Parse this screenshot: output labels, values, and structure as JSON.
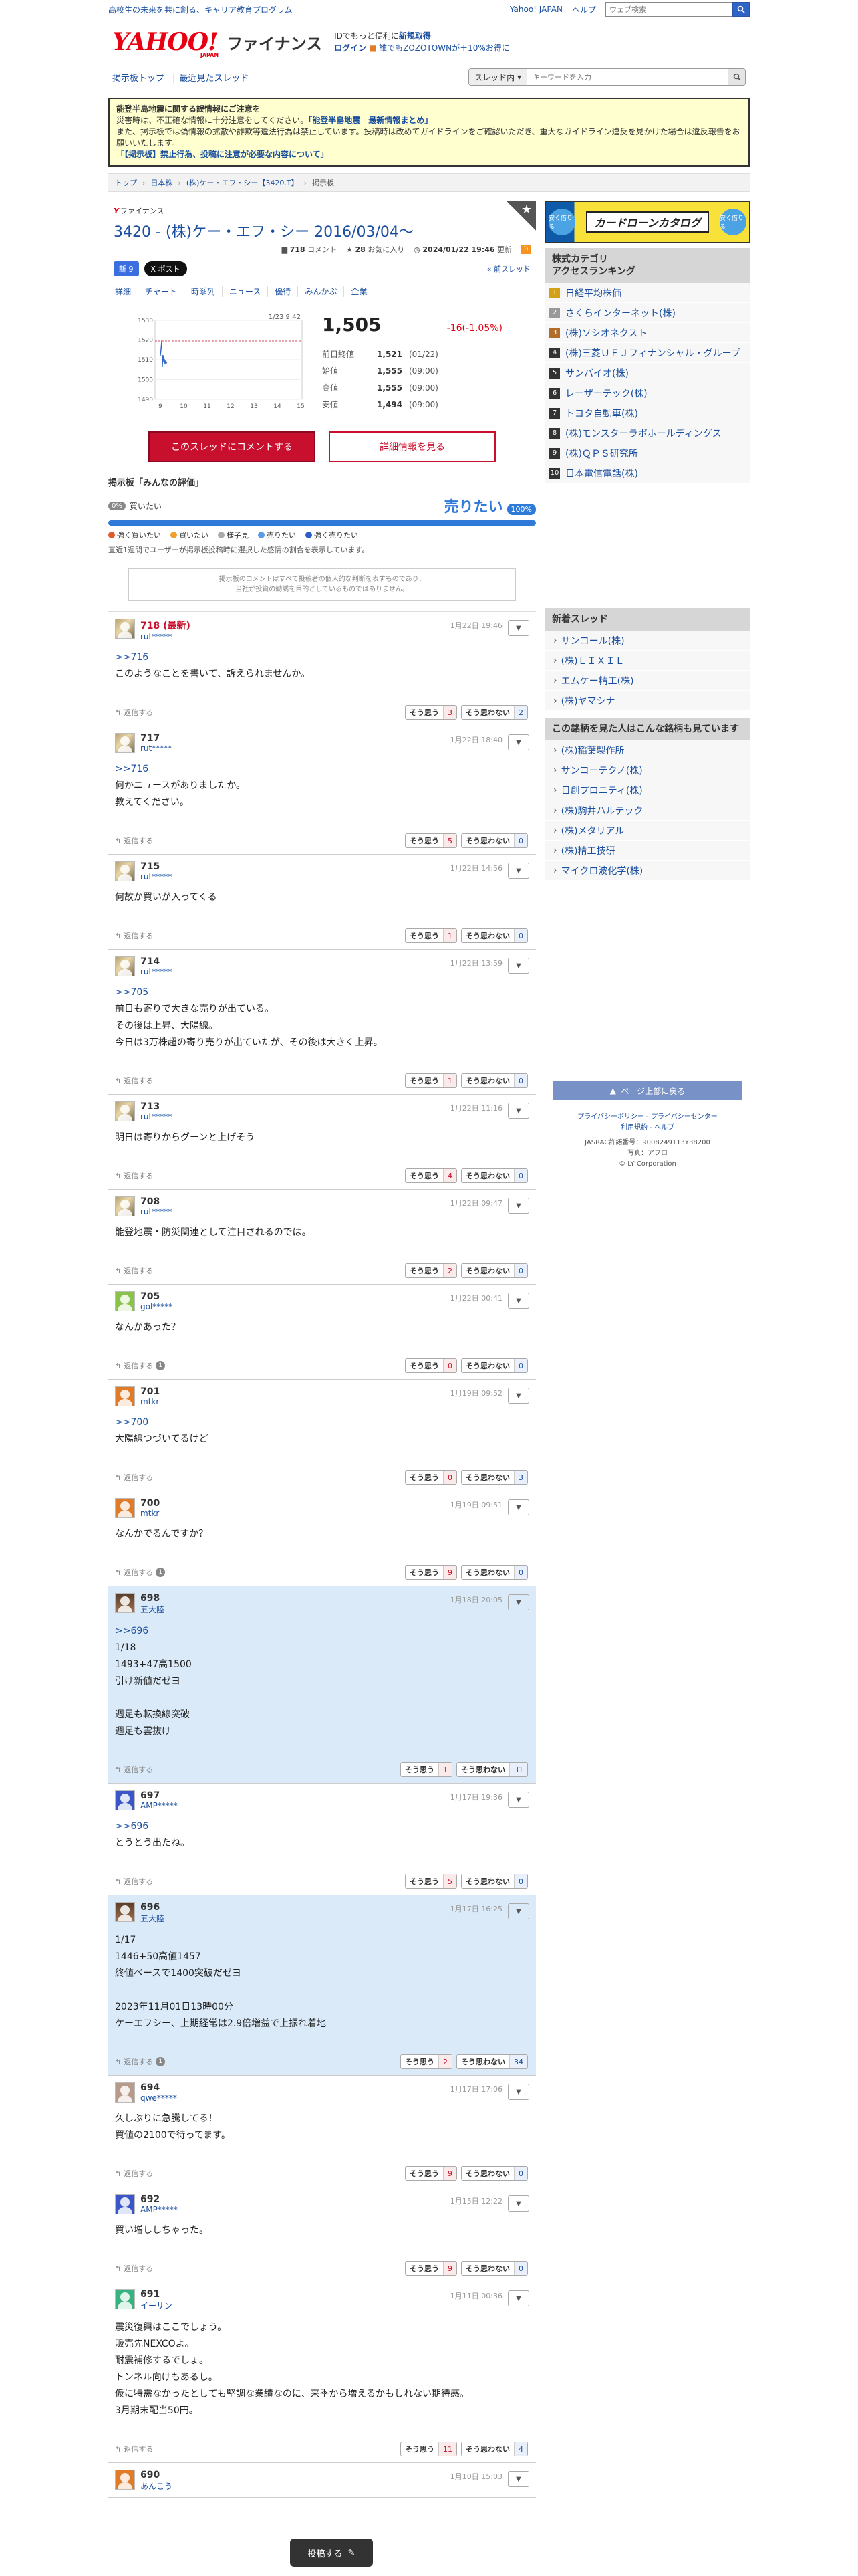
{
  "topbar": {
    "promo": "高校生の未来を共に創る、キャリア教育プログラム",
    "links": [
      "Yahoo! JAPAN",
      "ヘルプ"
    ],
    "search_placeholder": "ウェブ検索"
  },
  "header": {
    "logo": "YAHOO!",
    "logo_sub": "JAPAN",
    "service": "ファイナンス",
    "line1a": "IDでもっと便利に",
    "line1b": "新規取得",
    "login": "ログイン",
    "line2": "誰でもZOZOTOWNが＋10%お得に"
  },
  "nav": {
    "links": [
      "掲示板トップ",
      "最近見たスレッド"
    ],
    "select": "スレッド内",
    "search_placeholder": "キーワードを入力"
  },
  "notice": {
    "title": "能登半島地震に関する誤情報にご注意を",
    "l1a": "災害時は、不正確な情報に十分注意をしてください。",
    "l1b": "「能登半島地震　最新情報まとめ」",
    "l2": "また、掲示板では偽情報の拡散や詐欺等違法行為は禁止しています。投稿時は改めてガイドラインをご確認いただき、重大なガイドライン違反を見かけた場合は違反報告をお願いいたします。",
    "l3": "「【掲示板】禁止行為、投稿に注意が必要な内容について」"
  },
  "breadcrumb": [
    "トップ",
    "日本株",
    "(株)ケー・エフ・シー【3420.T】",
    "掲示板"
  ],
  "thread": {
    "brand": "ファイナンス",
    "title": "3420 - (株)ケー・エフ・シー 2016/03/04〜",
    "comments": "718",
    "comments_label": "コメント",
    "favs": "28",
    "favs_label": "お気に入り",
    "updated": "2024/01/22 19:46",
    "updated_label": "更新",
    "share1": "新 9",
    "share2": "X ポスト",
    "prev": "« 前スレッド"
  },
  "tabs": [
    "詳細",
    "チャート",
    "時系列",
    "ニュース",
    "優待",
    "みんかぶ",
    "企業"
  ],
  "price": {
    "time": "1/23 9:42",
    "value": "1,505",
    "change": "-16(-1.05%)",
    "rows": [
      {
        "l": "前日終値",
        "v": "1,521",
        "t": "(01/22)"
      },
      {
        "l": "始値",
        "v": "1,555",
        "t": "(09:00)"
      },
      {
        "l": "高値",
        "v": "1,555",
        "t": "(09:00)"
      },
      {
        "l": "安値",
        "v": "1,494",
        "t": "(09:00)"
      }
    ]
  },
  "chart_data": {
    "type": "line",
    "x": [
      "9",
      "10",
      "11",
      "12",
      "13",
      "14",
      "15"
    ],
    "yticks": [
      "1530",
      "1520",
      "1510",
      "1500",
      "1490"
    ],
    "ylim": [
      1490,
      1530
    ]
  },
  "buttons": {
    "comment": "このスレッドにコメントする",
    "detail": "詳細情報を見る"
  },
  "eval": {
    "title": "掲示板「みんなの評価」",
    "tag": "0%",
    "left": "買いたい",
    "right": "売りたい",
    "right_pct": "100%",
    "legend": [
      "強く買いたい",
      "買いたい",
      "様子見",
      "売りたい",
      "強く売りたい"
    ],
    "note": "直近1週間でユーザーが掲示板投稿時に選択した感情の割合を表示しています。",
    "legend_colors": [
      "#e05a2b",
      "#f3a02b",
      "#aaaaaa",
      "#5b9be6",
      "#2f5fc4"
    ]
  },
  "disclaimer": {
    "l1": "掲示板のコメントはすべて投稿者の個人的な判断を表すものであり、",
    "l2": "当社が投資の勧誘を目的としているものではありません。"
  },
  "labels": {
    "reply": "返信する",
    "yes": "そう思う",
    "no": "そう思わない"
  },
  "comments": [
    {
      "num": "718 (最新)",
      "user": "rut*****",
      "date": "1月22日 19:46",
      "lines": [
        ">>716",
        "このようなことを書いて、訴えられませんか。"
      ],
      "yes": "3",
      "no": "2",
      "latest": true
    },
    {
      "num": "717",
      "user": "rut*****",
      "date": "1月22日 18:40",
      "lines": [
        ">>716",
        "何かニュースがありましたか。",
        "教えてください。"
      ],
      "yes": "5",
      "no": "0"
    },
    {
      "num": "715",
      "user": "rut*****",
      "date": "1月22日 14:56",
      "lines": [
        "何故か買いが入ってくる"
      ],
      "yes": "1",
      "no": "0"
    },
    {
      "num": "714",
      "user": "rut*****",
      "date": "1月22日 13:59",
      "lines": [
        ">>705",
        "前日も寄りで大きな売りが出ている。",
        "その後は上昇、大陽線。",
        "今日は3万株超の寄り売りが出ていたが、その後は大きく上昇。"
      ],
      "yes": "1",
      "no": "0"
    },
    {
      "num": "713",
      "user": "rut*****",
      "date": "1月22日 11:16",
      "lines": [
        "明日は寄りからグーンと上げそう"
      ],
      "yes": "4",
      "no": "0"
    },
    {
      "num": "708",
      "user": "rut*****",
      "date": "1月22日 09:47",
      "lines": [
        "能登地震・防災関連として注目されるのでは。"
      ],
      "yes": "2",
      "no": "0"
    },
    {
      "num": "705",
      "user": "gol*****",
      "date": "1月22日 00:41",
      "lines": [
        "なんかあった？"
      ],
      "yes": "0",
      "no": "0",
      "rc": "1"
    },
    {
      "num": "701",
      "user": "mtkr",
      "date": "1月19日 09:52",
      "lines": [
        ">>700",
        "大陽線つづいてるけど"
      ],
      "yes": "0",
      "no": "3"
    },
    {
      "num": "700",
      "user": "mtkr",
      "date": "1月19日 09:51",
      "lines": [
        "なんかでるんですか？"
      ],
      "yes": "9",
      "no": "0",
      "rc": "1"
    },
    {
      "num": "698",
      "user": "五大陸",
      "date": "1月18日 20:05",
      "lines": [
        ">>696",
        "1/18",
        "1493+47高1500",
        "引け新値だゼヨ",
        "",
        "週足も転換線突破",
        "週足も雲抜け"
      ],
      "yes": "1",
      "no": "31",
      "hl": true
    },
    {
      "num": "697",
      "user": "AMP*****",
      "date": "1月17日 19:36",
      "lines": [
        ">>696",
        "とうとう出たね。"
      ],
      "yes": "5",
      "no": "0"
    },
    {
      "num": "696",
      "user": "五大陸",
      "date": "1月17日 16:25",
      "lines": [
        "1/17",
        "1446+50高値1457",
        "終値ベースで1400突破だゼヨ",
        "",
        "2023年11月01日13時00分",
        "ケーエフシー、上期経常は2.9倍増益で上振れ着地"
      ],
      "yes": "2",
      "no": "34",
      "hl": true,
      "rc": "1"
    },
    {
      "num": "694",
      "user": "qwe*****",
      "date": "1月17日 17:06",
      "lines": [
        "久しぶりに急騰してる！",
        "買値の2100で待ってます。"
      ],
      "yes": "9",
      "no": "0"
    },
    {
      "num": "692",
      "user": "AMP*****",
      "date": "1月15日 12:22",
      "lines": [
        "買い増ししちゃった。"
      ],
      "yes": "9",
      "no": "0"
    },
    {
      "num": "691",
      "user": "イーサン",
      "date": "1月11日 00:36",
      "lines": [
        "震災復興はここでしょう。",
        "販売先NEXCOよ。",
        "耐震補修するでしょ。",
        "トンネル向けもあるし。",
        "仮に特需なかったとしても堅調な業績なのに、来季から増えるかもしれない期待感。",
        "3月期末配当50円。"
      ],
      "yes": "11",
      "no": "4"
    },
    {
      "num": "690",
      "user": "あんこう",
      "date": "1月10日 15:03",
      "lines": [],
      "yes": "",
      "no": ""
    }
  ],
  "side": {
    "ad": "カードローンカタログ",
    "ad_l": "安く借りる",
    "ad_r": "安く借りる",
    "rank_title1": "株式カテゴリ",
    "rank_title2": "アクセスランキング",
    "rank": [
      "日経平均株価",
      "さくらインターネット(株)",
      "(株)ソシオネクスト",
      "(株)三菱ＵＦＪフィナンシャル・グループ",
      "サンバイオ(株)",
      "レーザーテック(株)",
      "トヨタ自動車(株)",
      "(株)モンスターラボホールディングス",
      "(株)ＱＰＳ研究所",
      "日本電信電話(株)"
    ],
    "new_title": "新着スレッド",
    "new": [
      "サンコール(株)",
      "(株)ＬＩＸＩＬ",
      "エムケー精工(株)",
      "(株)ヤマシナ"
    ],
    "also_title": "この銘柄を見た人はこんな銘柄も見ています",
    "also": [
      "(株)稲葉製作所",
      "サンコーテクノ(株)",
      "日創プロニティ(株)",
      "(株)駒井ハルテック",
      "(株)メタリアル",
      "(株)精工技研",
      "マイクロ波化学(株)"
    ],
    "totop": "ページ上部に戻る",
    "f1": "プライバシーポリシー - プライバシーセンター",
    "f2": "利用規約 - ヘルプ",
    "f3": "JASRAC許諾番号：9008249113Y38200",
    "f4": "写真：アフロ",
    "f5": "© LY Corporation"
  },
  "post": "投稿する"
}
